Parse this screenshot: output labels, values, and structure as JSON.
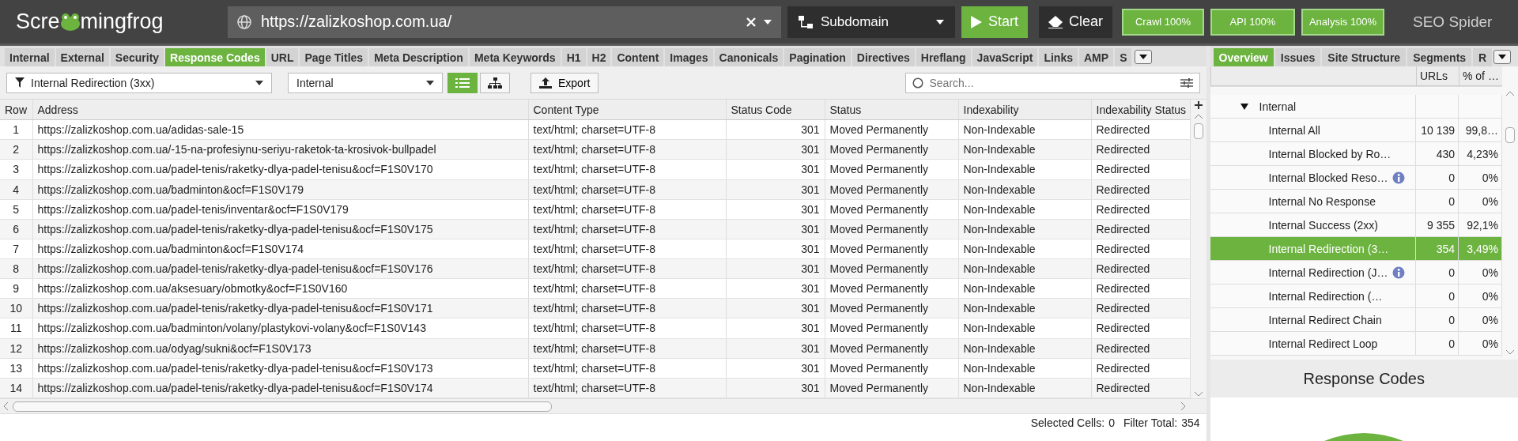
{
  "topbar": {
    "logo": [
      "Scre",
      "mingfrog"
    ],
    "url": "https://zalizkoshop.com.ua/",
    "mode": "Subdomain",
    "start": "Start",
    "clear": "Clear",
    "progress": [
      "Crawl 100%",
      "API 100%",
      "Analysis 100%"
    ],
    "product": "SEO Spider"
  },
  "tabs": [
    {
      "label": "Internal",
      "selected": false
    },
    {
      "label": "External",
      "selected": false
    },
    {
      "label": "Security",
      "selected": false
    },
    {
      "label": "Response Codes",
      "selected": true
    },
    {
      "label": "URL",
      "selected": false
    },
    {
      "label": "Page Titles",
      "selected": false
    },
    {
      "label": "Meta Description",
      "selected": false
    },
    {
      "label": "Meta Keywords",
      "selected": false
    },
    {
      "label": "H1",
      "selected": false
    },
    {
      "label": "H2",
      "selected": false
    },
    {
      "label": "Content",
      "selected": false
    },
    {
      "label": "Images",
      "selected": false
    },
    {
      "label": "Canonicals",
      "selected": false
    },
    {
      "label": "Pagination",
      "selected": false
    },
    {
      "label": "Directives",
      "selected": false
    },
    {
      "label": "Hreflang",
      "selected": false
    },
    {
      "label": "JavaScript",
      "selected": false
    },
    {
      "label": "Links",
      "selected": false
    },
    {
      "label": "AMP",
      "selected": false
    },
    {
      "label": "S",
      "selected": false
    }
  ],
  "filters": {
    "type": "Internal Redirection (3xx)",
    "scope": "Internal",
    "views": [
      {
        "kind": "list",
        "selected": true
      },
      {
        "kind": "tree",
        "selected": false
      }
    ],
    "export": "Export",
    "search": {
      "placeholder": "Search..."
    }
  },
  "table": {
    "columns": [
      "Row",
      "Address",
      "Content Type",
      "Status Code",
      "Status",
      "Indexability",
      "Indexability Status"
    ],
    "rows": [
      [
        "1",
        "https://zalizkoshop.com.ua/adidas-sale-15",
        "text/html; charset=UTF-8",
        "301",
        "Moved Permanently",
        "Non-Indexable",
        "Redirected"
      ],
      [
        "2",
        "https://zalizkoshop.com.ua/-15-na-profesiynu-seriyu-raketok-ta-krosivok-bullpadel",
        "text/html; charset=UTF-8",
        "301",
        "Moved Permanently",
        "Non-Indexable",
        "Redirected"
      ],
      [
        "3",
        "https://zalizkoshop.com.ua/padel-tenis/raketky-dlya-padel-tenisu&ocf=F1S0V170",
        "text/html; charset=UTF-8",
        "301",
        "Moved Permanently",
        "Non-Indexable",
        "Redirected"
      ],
      [
        "4",
        "https://zalizkoshop.com.ua/badminton&ocf=F1S0V179",
        "text/html; charset=UTF-8",
        "301",
        "Moved Permanently",
        "Non-Indexable",
        "Redirected"
      ],
      [
        "5",
        "https://zalizkoshop.com.ua/padel-tenis/inventar&ocf=F1S0V179",
        "text/html; charset=UTF-8",
        "301",
        "Moved Permanently",
        "Non-Indexable",
        "Redirected"
      ],
      [
        "6",
        "https://zalizkoshop.com.ua/padel-tenis/raketky-dlya-padel-tenisu&ocf=F1S0V175",
        "text/html; charset=UTF-8",
        "301",
        "Moved Permanently",
        "Non-Indexable",
        "Redirected"
      ],
      [
        "7",
        "https://zalizkoshop.com.ua/badminton&ocf=F1S0V174",
        "text/html; charset=UTF-8",
        "301",
        "Moved Permanently",
        "Non-Indexable",
        "Redirected"
      ],
      [
        "8",
        "https://zalizkoshop.com.ua/padel-tenis/raketky-dlya-padel-tenisu&ocf=F1S0V176",
        "text/html; charset=UTF-8",
        "301",
        "Moved Permanently",
        "Non-Indexable",
        "Redirected"
      ],
      [
        "9",
        "https://zalizkoshop.com.ua/aksesuary/obmotky&ocf=F1S0V160",
        "text/html; charset=UTF-8",
        "301",
        "Moved Permanently",
        "Non-Indexable",
        "Redirected"
      ],
      [
        "10",
        "https://zalizkoshop.com.ua/padel-tenis/raketky-dlya-padel-tenisu&ocf=F1S0V171",
        "text/html; charset=UTF-8",
        "301",
        "Moved Permanently",
        "Non-Indexable",
        "Redirected"
      ],
      [
        "11",
        "https://zalizkoshop.com.ua/badminton/volany/plastykovi-volany&ocf=F1S0V143",
        "text/html; charset=UTF-8",
        "301",
        "Moved Permanently",
        "Non-Indexable",
        "Redirected"
      ],
      [
        "12",
        "https://zalizkoshop.com.ua/odyag/sukni&ocf=F1S0V173",
        "text/html; charset=UTF-8",
        "301",
        "Moved Permanently",
        "Non-Indexable",
        "Redirected"
      ],
      [
        "13",
        "https://zalizkoshop.com.ua/padel-tenis/raketky-dlya-padel-tenisu&ocf=F1S0V173",
        "text/html; charset=UTF-8",
        "301",
        "Moved Permanently",
        "Non-Indexable",
        "Redirected"
      ],
      [
        "14",
        "https://zalizkoshop.com.ua/padel-tenis/raketky-dlya-padel-tenisu&ocf=F1S0V174",
        "text/html; charset=UTF-8",
        "301",
        "Moved Permanently",
        "Non-Indexable",
        "Redirected"
      ]
    ]
  },
  "status_bar": {
    "selected_label": "Selected Cells:",
    "selected": "0",
    "total_label": "Filter Total:",
    "total": "354"
  },
  "side": {
    "tabs": [
      {
        "label": "Overview",
        "selected": true
      },
      {
        "label": "Issues",
        "selected": false
      },
      {
        "label": "Site Structure",
        "selected": false
      },
      {
        "label": "Segments",
        "selected": false
      },
      {
        "label": "R",
        "selected": false
      }
    ],
    "columns": [
      "URLs",
      "% of …"
    ],
    "tree": [
      {
        "label": "Internal",
        "expanded": true,
        "children": [
          {
            "label": "Internal All",
            "urls": "10 139",
            "percent": "99,8…",
            "info": false,
            "selected": false
          },
          {
            "label": "Internal Blocked by Ro…",
            "urls": "430",
            "percent": "4,23%",
            "info": false,
            "selected": false
          },
          {
            "label": "Internal Blocked Reso…",
            "urls": "0",
            "percent": "0%",
            "info": true,
            "selected": false
          },
          {
            "label": "Internal No Response",
            "urls": "0",
            "percent": "0%",
            "info": false,
            "selected": false
          },
          {
            "label": "Internal Success (2xx)",
            "urls": "9 355",
            "percent": "92,1%",
            "info": false,
            "selected": false
          },
          {
            "label": "Internal Redirection (3…",
            "urls": "354",
            "percent": "3,49%",
            "info": false,
            "selected": true
          },
          {
            "label": "Internal Redirection (J…",
            "urls": "0",
            "percent": "0%",
            "info": true,
            "selected": false
          },
          {
            "label": "Internal Redirection (…",
            "urls": "0",
            "percent": "0%",
            "info": false,
            "selected": false
          },
          {
            "label": "Internal Redirect Chain",
            "urls": "0",
            "percent": "0%",
            "info": false,
            "selected": false
          },
          {
            "label": "Internal Redirect Loop",
            "urls": "0",
            "percent": "0%",
            "info": false,
            "selected": false
          }
        ]
      }
    ],
    "chart_title": "Response Codes"
  }
}
